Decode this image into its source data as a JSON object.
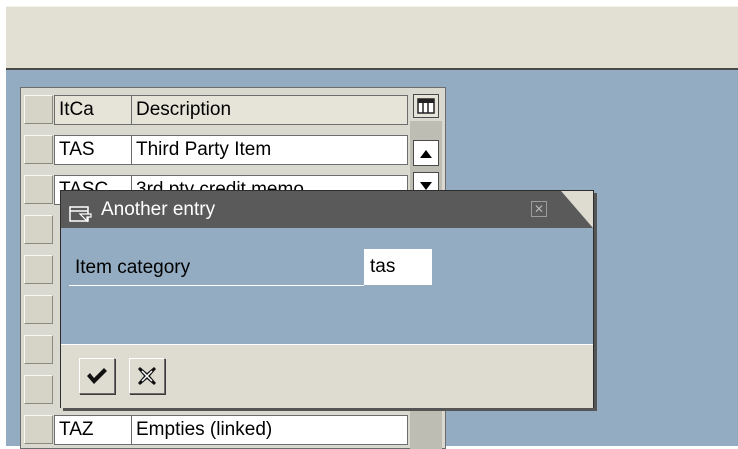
{
  "table": {
    "header": {
      "code": "ItCa",
      "description": "Description"
    },
    "rows": [
      {
        "code": "TAS",
        "description": "Third Party Item"
      },
      {
        "code": "TASC",
        "description": "3rd pty credit memo"
      },
      {
        "code": "",
        "description": ""
      },
      {
        "code": "",
        "description": ""
      },
      {
        "code": "",
        "description": ""
      },
      {
        "code": "",
        "description": ""
      },
      {
        "code": "",
        "description": ""
      },
      {
        "code": "",
        "description": ""
      },
      {
        "code": "",
        "description": ""
      },
      {
        "code": "TAZ",
        "description": "Empties (linked)"
      }
    ]
  },
  "dialog": {
    "title": "Another entry",
    "field_label": "Item category",
    "field_value": "tas"
  },
  "icons": {
    "confirm": "checkmark-icon",
    "cancel": "cancel-x-icon",
    "close": "close-icon",
    "column_config": "column-config-icon"
  }
}
